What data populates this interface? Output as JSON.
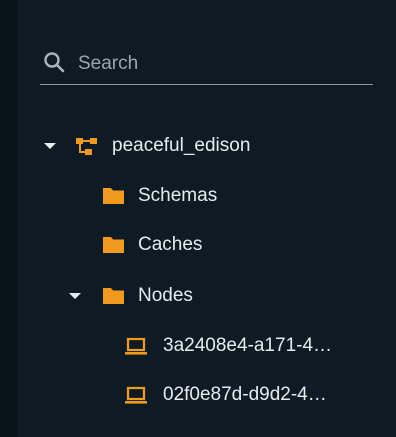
{
  "search": {
    "placeholder": "Search"
  },
  "tree": {
    "root": {
      "label": "peaceful_edison",
      "expanded": true,
      "icon": "cluster-icon"
    },
    "children": [
      {
        "label": "Schemas",
        "icon": "folder-icon"
      },
      {
        "label": "Caches",
        "icon": "folder-icon"
      },
      {
        "label": "Nodes",
        "icon": "folder-icon",
        "expanded": true
      }
    ],
    "nodes": [
      {
        "label": "3a2408e4-a171-4…",
        "icon": "laptop-icon"
      },
      {
        "label": "02f0e87d-d9d2-4…",
        "icon": "laptop-icon"
      }
    ]
  },
  "colors": {
    "background": "#0f1b24",
    "accent": "#f29a1d",
    "text": "#e6ebee"
  }
}
